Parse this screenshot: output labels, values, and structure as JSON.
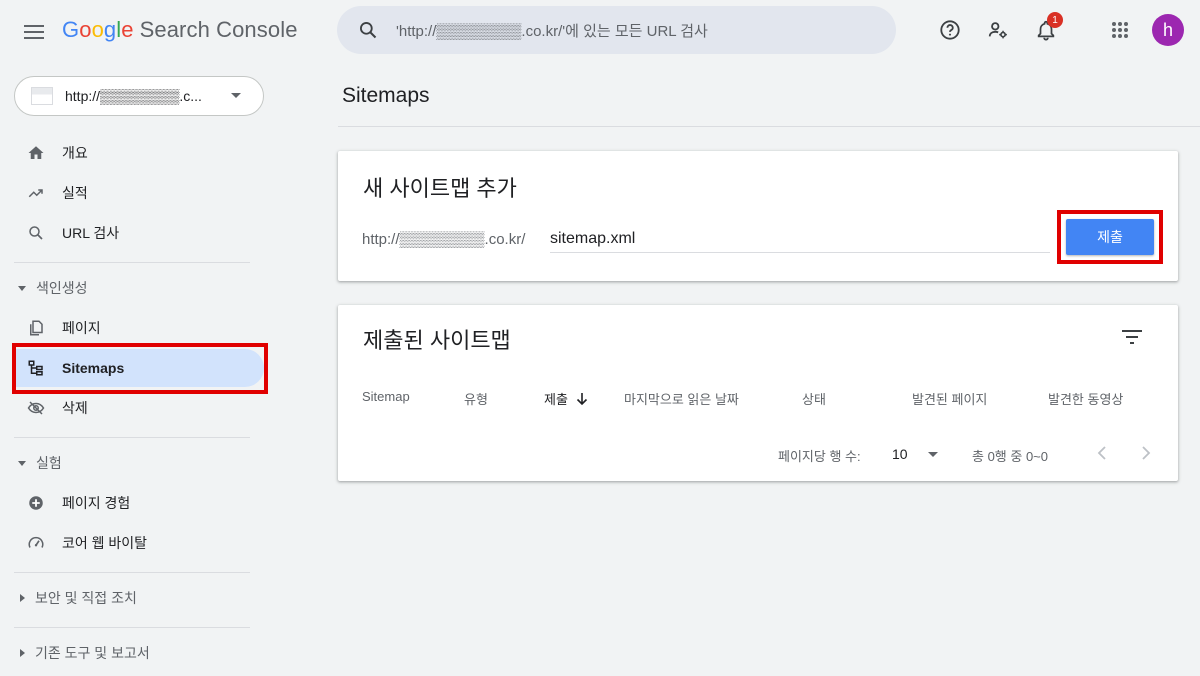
{
  "header": {
    "logo_google": [
      "G",
      "o",
      "o",
      "g",
      "l",
      "e"
    ],
    "logo_product": "Search Console",
    "search_placeholder": "'http://▒▒▒▒▒▒▒▒.co.kr/'에 있는 모든 URL 검사",
    "notification_count": "1",
    "avatar_initial": "h",
    "icons": [
      "menu-icon",
      "search-icon",
      "help-icon",
      "manage-users-icon",
      "notifications-icon",
      "apps-grid-icon"
    ]
  },
  "sidebar": {
    "property_label": "http://▒▒▒▒▒▒▒▒.c...",
    "items": [
      {
        "label": "개요",
        "icon": "home-icon"
      },
      {
        "label": "실적",
        "icon": "trending-up-icon"
      },
      {
        "label": "URL 검사",
        "icon": "search-icon"
      }
    ],
    "section_indexing": "색인생성",
    "indexing_items": [
      {
        "label": "페이지",
        "icon": "pages-icon"
      },
      {
        "label": "Sitemaps",
        "icon": "sitemap-icon",
        "active": true
      },
      {
        "label": "삭제",
        "icon": "visibility-off-icon"
      }
    ],
    "section_experience": "실험",
    "experience_items": [
      {
        "label": "페이지 경험",
        "icon": "plus-circle-icon"
      },
      {
        "label": "코어 웹 바이탈",
        "icon": "speed-gauge-icon"
      }
    ],
    "section_security": "보안 및 직접 조치",
    "section_legacy": "기존 도구 및 보고서"
  },
  "main": {
    "page_title": "Sitemaps",
    "add_card": {
      "title": "새 사이트맵 추가",
      "url_prefix": "http://▒▒▒▒▒▒▒▒.co.kr/",
      "input_value": "sitemap.xml",
      "submit_label": "제출"
    },
    "submitted_card": {
      "title": "제출된 사이트맵",
      "columns": [
        "Sitemap",
        "유형",
        "제출",
        "마지막으로 읽은 날짜",
        "상태",
        "발견된 페이지",
        "발견한 동영상"
      ],
      "sorted_column": "제출",
      "rows_per_page_label": "페이지당 행 수:",
      "rows_per_page_value": "10",
      "range_label": "총 0행 중 0~0"
    }
  },
  "colors": {
    "accent_blue": "#4285f4",
    "active_nav_bg": "#d2e3fc",
    "highlight_red": "#e00000",
    "avatar_purple": "#9c27b0",
    "badge_red": "#d93025"
  }
}
